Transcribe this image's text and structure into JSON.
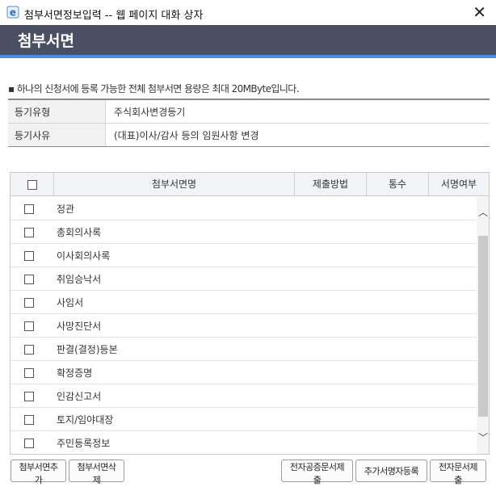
{
  "window": {
    "title": "첨부서면정보입력 -- 웹 페이지 대화 상자",
    "close_glyph": "✕",
    "icon": "ie-icon"
  },
  "header": {
    "title": "첨부서면"
  },
  "notice": "▪ 하나의 신청서에 등록 가능한 전체 첨부서면 용량은 최대 20MByte입니다.",
  "info": [
    {
      "label": "등기유형",
      "value": "주식회사변경등기"
    },
    {
      "label": "등기사유",
      "value": "(대표)이사/감사 등의 임원사항 변경"
    }
  ],
  "table": {
    "columns": [
      "첨부서면명",
      "제출방법",
      "통수",
      "서명여부"
    ],
    "rows": [
      "정관",
      "총회의사록",
      "이사회의사록",
      "취임승낙서",
      "사임서",
      "사망진단서",
      "판결(결정)등본",
      "확정증명",
      "인감신고서",
      "토지/임야대장",
      "주민등록정보"
    ]
  },
  "scrollbar": {
    "up": "︿",
    "down": "﹀"
  },
  "buttons": {
    "add": "첨부서면추가",
    "delete": "첨부서면삭제",
    "e_public_doc": "전자공증문서제출",
    "add_signer": "추가서명자등록",
    "e_doc": "전자문서제출"
  },
  "colors": {
    "header_bg": "#4a4f63",
    "accent": "#4f8bd9"
  }
}
